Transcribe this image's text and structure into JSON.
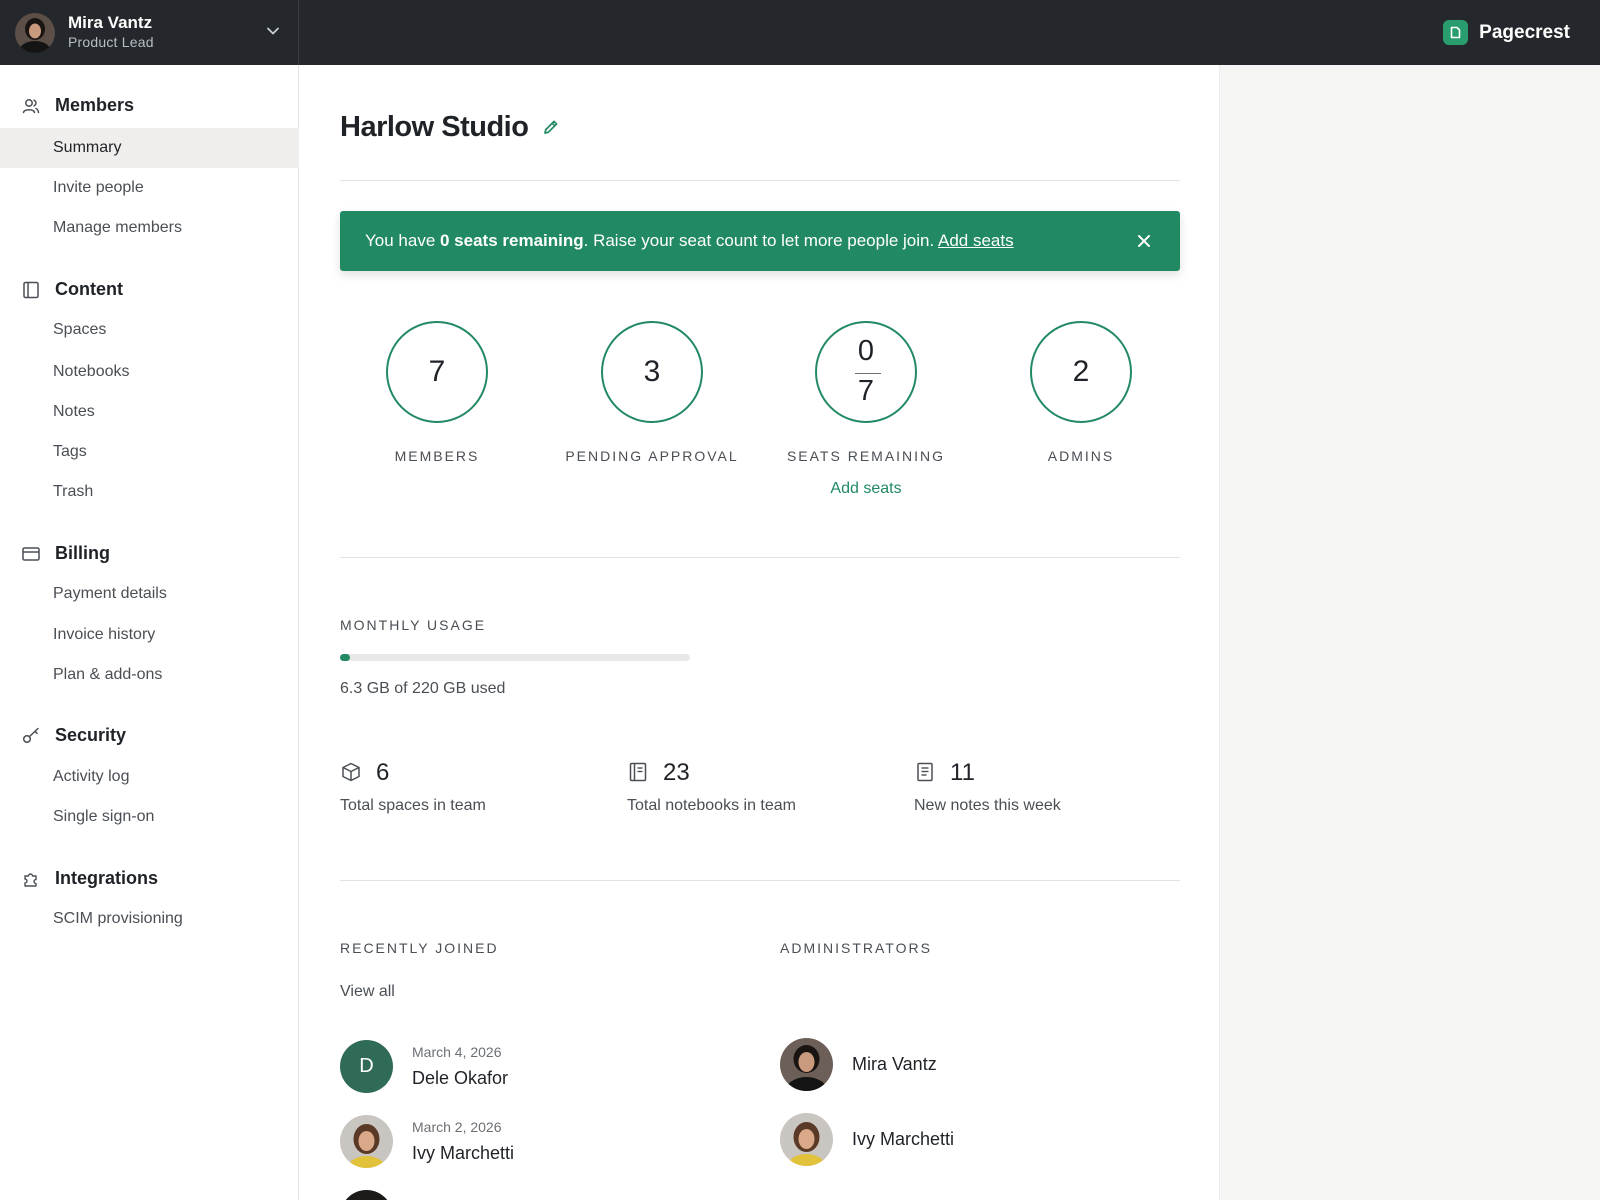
{
  "account": {
    "name": "Mira Vantz",
    "role": "Product Lead"
  },
  "brand": {
    "name": "Pagecrest",
    "accent": "#2a9d6e"
  },
  "sidebar": {
    "sections": [
      {
        "title": "Members",
        "icon": "users-icon",
        "items": [
          "Summary",
          "Invite people",
          "Manage members"
        ]
      },
      {
        "title": "Content",
        "icon": "book-icon",
        "items": [
          "Spaces",
          "Notebooks",
          "Notes",
          "Tags",
          "Trash"
        ]
      },
      {
        "title": "Billing",
        "icon": "credit-card-icon",
        "items": [
          "Payment details",
          "Invoice history",
          "Plan & add-ons"
        ]
      },
      {
        "title": "Security",
        "icon": "key-icon",
        "items": [
          "Activity log",
          "Single sign-on"
        ]
      },
      {
        "title": "Integrations",
        "icon": "puzzle-icon",
        "items": [
          "SCIM provisioning"
        ]
      }
    ],
    "active_item": "Summary"
  },
  "main": {
    "title": "Harlow Studio",
    "banner": {
      "prefix": "You have ",
      "bold": "0 seats remaining",
      "suffix": ". Raise your seat count to let more people join. ",
      "link": "Add seats",
      "color": "#228a62"
    },
    "stats": {
      "members": {
        "value": "7",
        "label": "MEMBERS"
      },
      "pending": {
        "value": "3",
        "label": "PENDING APPROVAL"
      },
      "seats": {
        "remaining": "0",
        "total": "7",
        "label": "SEATS REMAINING",
        "link": "Add seats"
      },
      "admins": {
        "value": "2",
        "label": "ADMINS"
      }
    },
    "usage": {
      "heading": "MONTHLY USAGE",
      "text": "6.3 GB of 220 GB used",
      "fraction": 0.029
    },
    "counts": {
      "spaces": {
        "value": "6",
        "label": "Total spaces in team",
        "icon": "cube-icon"
      },
      "notebooks": {
        "value": "23",
        "label": "Total notebooks in team",
        "icon": "notebook-icon"
      },
      "notes": {
        "value": "11",
        "label": "New notes this week",
        "icon": "note-icon"
      }
    },
    "recent": {
      "heading": "RECENTLY JOINED",
      "view_all": "View all",
      "people": [
        {
          "date": "March 4, 2026",
          "name": "Dele Okafor",
          "initial": "D"
        },
        {
          "date": "March 2, 2026",
          "name": "Ivy Marchetti"
        }
      ]
    },
    "admins": {
      "heading": "ADMINISTRATORS",
      "people": [
        {
          "name": "Mira Vantz"
        },
        {
          "name": "Ivy Marchetti"
        }
      ]
    }
  }
}
